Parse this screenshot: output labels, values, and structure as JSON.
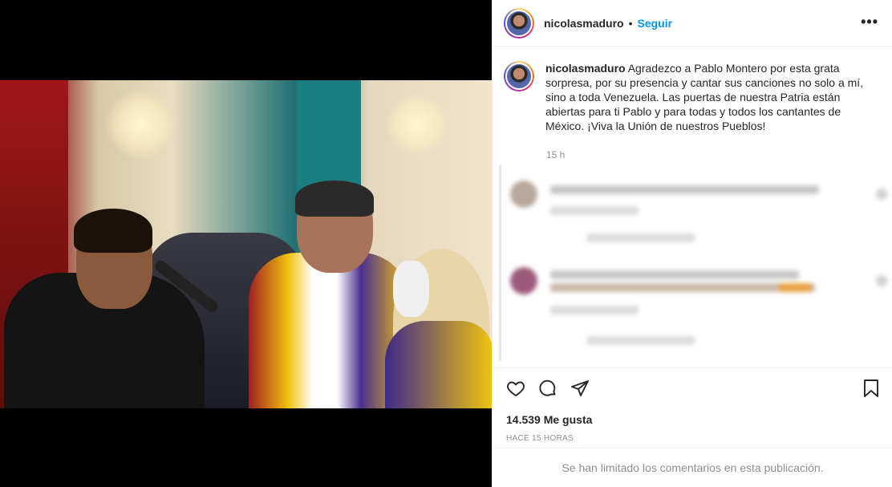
{
  "post": {
    "username": "nicolasmaduro",
    "separator": "•",
    "follow_label": "Seguir",
    "more_label": "•••",
    "caption": "Agradezco a Pablo Montero por esta grata sorpresa, por su presencia y cantar sus canciones no solo a mí, sino a toda Venezuela. Las puertas de nuestra Patria están abiertas para ti Pablo y para todas y todos los cantantes de México. ¡Viva la Unión de nuestros Pueblos!",
    "caption_time": "15 h",
    "likes": "14.539 Me gusta",
    "posted_ago": "HACE 15 HORAS",
    "comments_limited": "Se han limitado los comentarios en esta publicación."
  },
  "icons": {
    "like": "heart-icon",
    "comment": "comment-icon",
    "share": "paper-plane-icon",
    "save": "bookmark-icon"
  },
  "colors": {
    "accent": "#0095f6",
    "text": "#262626",
    "muted": "#8e8e8e",
    "border": "#efefef"
  }
}
